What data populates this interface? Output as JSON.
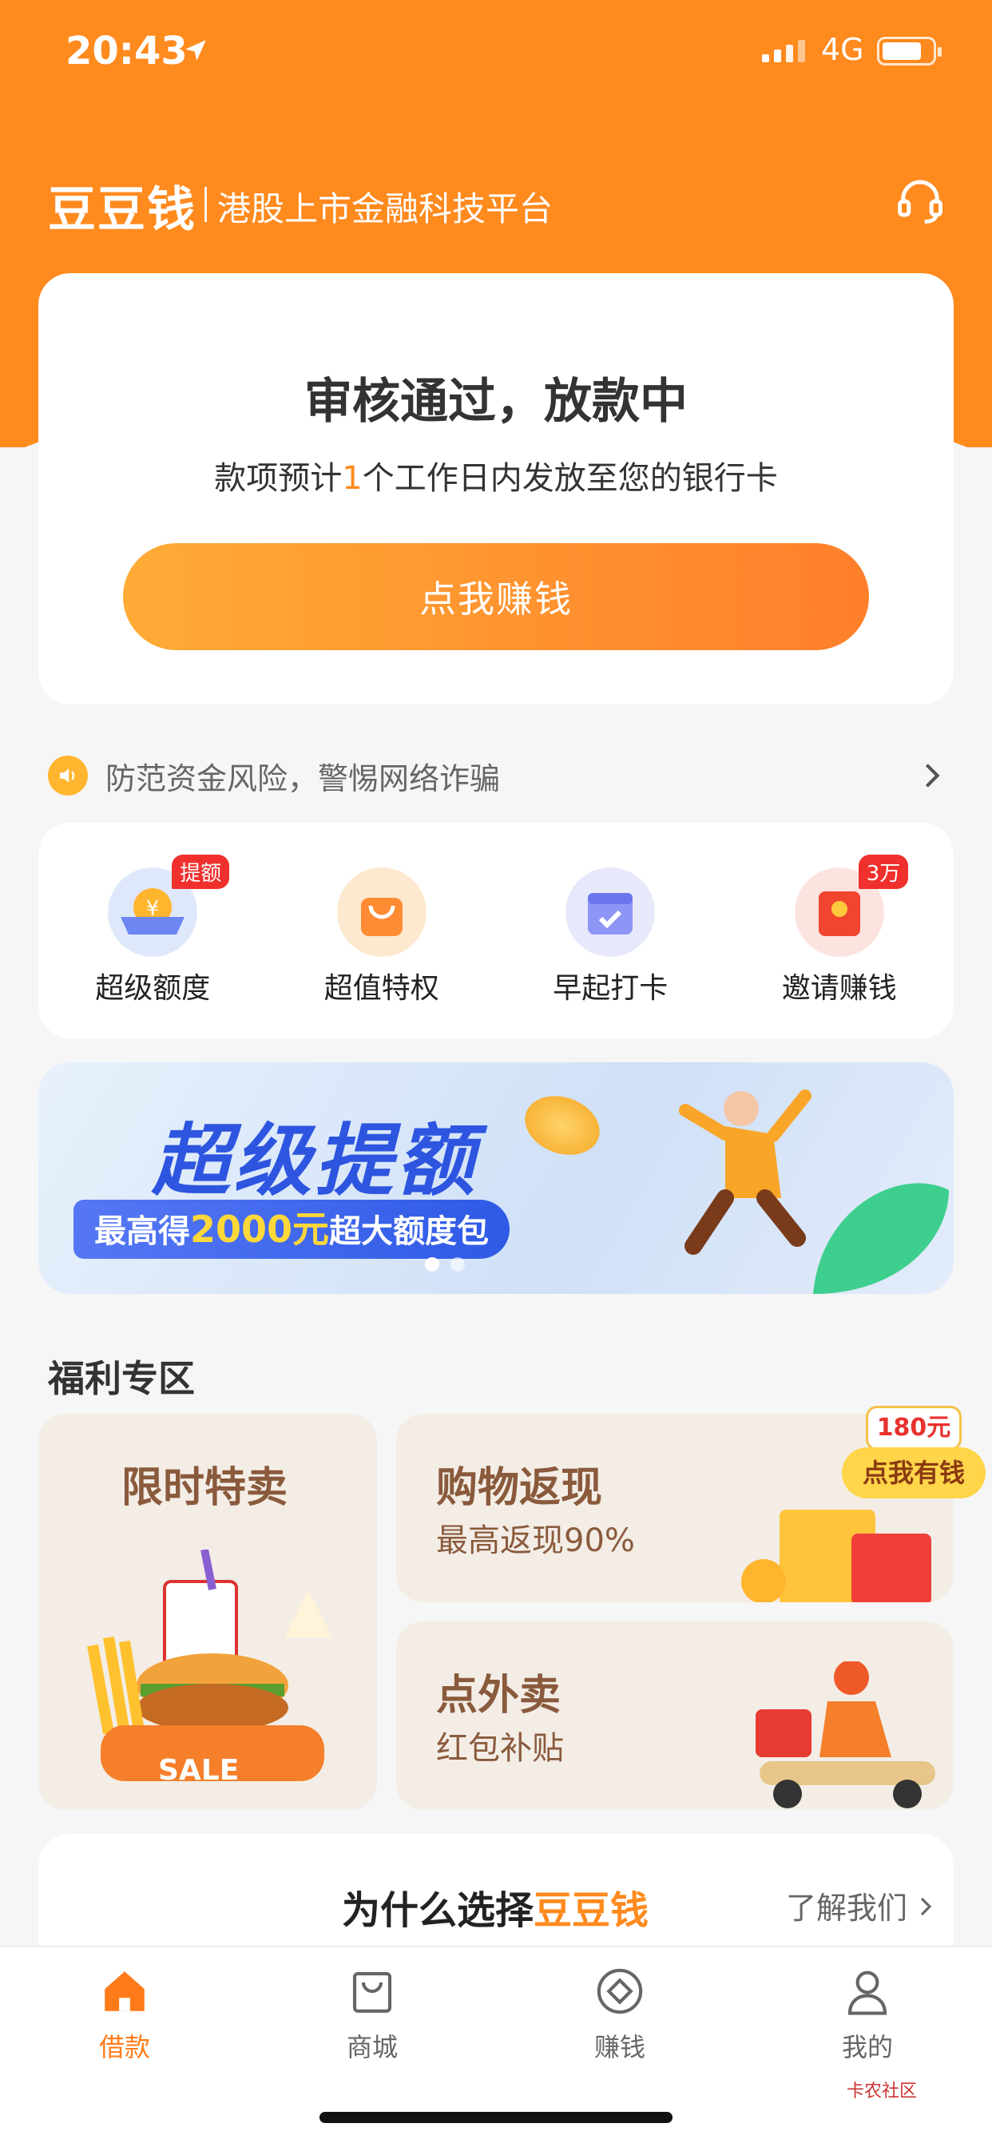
{
  "status_bar": {
    "time": "20:43",
    "network": "4G"
  },
  "header": {
    "brand": "豆豆钱",
    "slogan": "港股上市金融科技平台"
  },
  "status_card": {
    "title": "审核通过，放款中",
    "desc_before": "款项预计",
    "desc_days": "1",
    "desc_after": "个工作日内发放至您的银行卡",
    "cta": "点我赚钱"
  },
  "notice": {
    "text": "防范资金风险，警惕网络诈骗"
  },
  "entries": [
    {
      "label": "超级额度",
      "badge": "提额",
      "icon": "coin-wallet-icon"
    },
    {
      "label": "超值特权",
      "badge": "",
      "icon": "shopping-bag-icon"
    },
    {
      "label": "早起打卡",
      "badge": "",
      "icon": "calendar-check-icon"
    },
    {
      "label": "邀请赚钱",
      "badge": "3万",
      "icon": "red-envelope-icon"
    }
  ],
  "banner": {
    "headline": "超级提额",
    "sub_before": "最高得",
    "sub_amount": "2000元",
    "sub_after": "超大额度包"
  },
  "welfare": {
    "title": "福利专区",
    "tiles": [
      {
        "title": "限时特卖",
        "subtitle": "",
        "sale_tag": "SALE"
      },
      {
        "title": "购物返现",
        "subtitle": "最高返现90%",
        "tag_amount": "180元",
        "tag_cta": "点我有钱"
      },
      {
        "title": "点外卖",
        "subtitle": "红包补贴"
      }
    ]
  },
  "why": {
    "before": "为什么选择",
    "brand": "豆豆钱",
    "more": "了解我们"
  },
  "tabbar": [
    {
      "label": "借款",
      "icon": "home-icon",
      "active": true
    },
    {
      "label": "商城",
      "icon": "bag-icon",
      "active": false
    },
    {
      "label": "赚钱",
      "icon": "diamond-coin-icon",
      "active": false
    },
    {
      "label": "我的",
      "icon": "user-icon",
      "active": false
    }
  ],
  "watermark": "卡农社区",
  "colors": {
    "primary": "#ff8a1e",
    "badge": "#f0302d",
    "banner_blue": "#2d55e0"
  }
}
